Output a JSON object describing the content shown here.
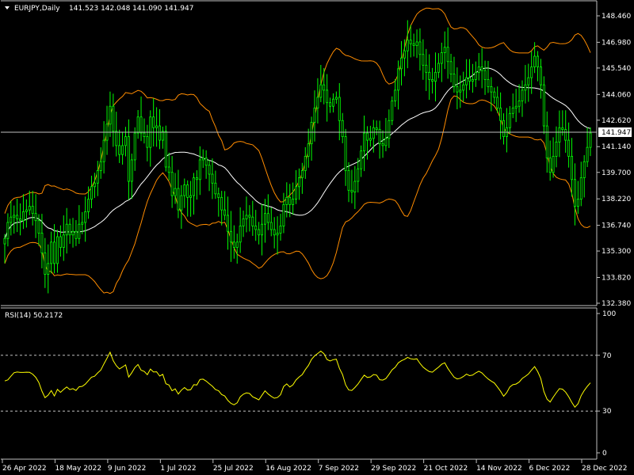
{
  "header": {
    "symbol": "EURJPY,Daily",
    "ohlc": "141.523 142.048 141.090 141.947",
    "current_price_label": "141.947"
  },
  "rsi_panel": {
    "label": "RSI(14) 50.2172",
    "levels": [
      30,
      70
    ]
  },
  "colors": {
    "background": "#000000",
    "candle": "#00ff00",
    "ma": "#ffffff",
    "bands": "#ff8c00",
    "rsi": "#ffff00",
    "grid": "#ffffff"
  },
  "chart_data": [
    {
      "type": "candlestick",
      "title": "EURJPY,Daily",
      "x_tick_labels": [
        "26 Apr 2022",
        "18 May 2022",
        "9 Jun 2022",
        "1 Jul 2022",
        "25 Jul 2022",
        "16 Aug 2022",
        "7 Sep 2022",
        "29 Sep 2022",
        "21 Oct 2022",
        "14 Nov 2022",
        "6 Dec 2022",
        "28 Dec 2022"
      ],
      "y_tick_labels": [
        148.46,
        146.98,
        145.54,
        144.06,
        142.62,
        141.14,
        139.7,
        138.22,
        136.74,
        135.3,
        133.82,
        132.38
      ],
      "ylim": [
        132.38,
        148.46
      ],
      "overlays": [
        "moving-average",
        "envelope-bands"
      ],
      "closes": [
        136.0,
        136.9,
        137.2,
        137.3,
        137.1,
        137.0,
        137.5,
        137.6,
        137.8,
        137.4,
        137.0,
        136.3,
        135.2,
        134.0,
        134.6,
        135.8,
        134.6,
        136.1,
        135.5,
        136.2,
        136.8,
        136.2,
        136.4,
        136.0,
        136.8,
        136.9,
        137.5,
        138.2,
        138.9,
        139.1,
        139.8,
        140.3,
        141.5,
        142.4,
        143.4,
        142.0,
        141.2,
        140.7,
        141.2,
        141.7,
        139.2,
        140.4,
        141.9,
        142.8,
        141.9,
        141.7,
        141.1,
        142.8,
        142.2,
        142.3,
        141.5,
        142.0,
        140.0,
        139.7,
        138.4,
        138.8,
        137.6,
        138.4,
        139.0,
        138.3,
        138.4,
        139.4,
        139.3,
        140.4,
        140.5,
        140.1,
        139.6,
        139.1,
        138.5,
        138.3,
        137.6,
        137.3,
        136.4,
        135.8,
        135.5,
        135.8,
        136.7,
        137.1,
        137.3,
        137.2,
        136.7,
        136.5,
        136.2,
        136.8,
        137.4,
        136.9,
        136.5,
        136.2,
        136.3,
        136.7,
        137.9,
        138.3,
        137.9,
        138.2,
        138.9,
        139.4,
        139.8,
        140.6,
        141.3,
        142.5,
        143.3,
        143.9,
        144.6,
        144.3,
        143.6,
        143.4,
        143.8,
        143.9,
        142.6,
        141.7,
        139.8,
        138.7,
        138.6,
        139.2,
        139.9,
        140.9,
        141.9,
        141.5,
        141.6,
        142.2,
        142.1,
        141.3,
        141.2,
        141.6,
        142.6,
        143.7,
        144.3,
        145.5,
        146.1,
        146.5,
        147.1,
        146.9,
        146.8,
        147.0,
        146.3,
        145.7,
        145.3,
        144.9,
        144.8,
        145.3,
        145.8,
        146.4,
        146.7,
        145.9,
        145.2,
        144.5,
        144.2,
        144.3,
        144.6,
        145.0,
        144.8,
        144.9,
        145.3,
        145.6,
        145.4,
        144.9,
        144.5,
        144.2,
        143.9,
        143.3,
        142.6,
        141.7,
        142.2,
        143.0,
        143.3,
        143.4,
        143.7,
        144.3,
        144.6,
        145.0,
        145.6,
        146.2,
        145.6,
        144.6,
        142.3,
        140.5,
        139.7,
        140.6,
        141.4,
        142.2,
        142.1,
        141.5,
        140.6,
        139.3,
        137.8,
        138.2,
        139.4,
        140.3,
        141.1,
        141.9
      ]
    },
    {
      "type": "line",
      "title": "RSI(14) 50.2172",
      "ylim": [
        0,
        100
      ],
      "y_tick_labels": [
        100,
        70,
        30,
        0
      ],
      "reference_lines": [
        30,
        70
      ],
      "values": [
        51.6,
        52.4,
        55.0,
        57.5,
        58.0,
        57.7,
        57.7,
        57.9,
        57.8,
        56.5,
        54.2,
        50.5,
        44.3,
        39.6,
        41.4,
        44.7,
        40.8,
        45.5,
        43.4,
        45.5,
        47.3,
        45.4,
        46.1,
        44.8,
        47.4,
        47.7,
        49.3,
        51.8,
        54.3,
        55.0,
        57.4,
        59.4,
        63.8,
        67.9,
        72.2,
        66.1,
        62.5,
        60.2,
        61.6,
        63.1,
        54.4,
        57.5,
        61.2,
        63.4,
        59.3,
        58.4,
        56.1,
        60.1,
        58.0,
        58.2,
        55.1,
        56.3,
        49.6,
        48.7,
        44.6,
        45.9,
        42.2,
        45.0,
        46.9,
        45.0,
        45.3,
        48.9,
        48.7,
        52.6,
        52.9,
        51.5,
        49.6,
        47.8,
        45.4,
        44.6,
        41.9,
        40.8,
        37.6,
        35.5,
        34.5,
        35.9,
        40.2,
        42.1,
        43.0,
        42.6,
        40.2,
        39.2,
        38.0,
        41.3,
        44.5,
        42.2,
        40.5,
        39.2,
        39.7,
        41.7,
        47.6,
        49.5,
        47.3,
        48.8,
        52.3,
        54.5,
        56.2,
        59.8,
        62.7,
        67.1,
        69.6,
        71.3,
        73.0,
        71.2,
        67.0,
        65.9,
        66.9,
        67.2,
        60.6,
        56.2,
        48.8,
        45.1,
        44.8,
        46.9,
        49.4,
        52.7,
        55.8,
        54.1,
        54.5,
        56.2,
        55.8,
        52.5,
        52.2,
        53.3,
        56.3,
        59.6,
        61.4,
        64.6,
        66.1,
        67.1,
        68.5,
        67.5,
        67.1,
        67.5,
        64.2,
        61.5,
        59.8,
        58.3,
        57.9,
        59.8,
        61.5,
        63.6,
        64.6,
        60.6,
        57.4,
        54.3,
        53.0,
        53.5,
        54.8,
        56.5,
        55.4,
        55.8,
        57.4,
        58.6,
        57.4,
        55.0,
        53.0,
        51.5,
        50.1,
        47.3,
        44.2,
        40.6,
        43.2,
        47.3,
        48.9,
        49.4,
        50.8,
        53.4,
        54.9,
        56.6,
        59.4,
        61.9,
        58.3,
        53.3,
        44.0,
        38.5,
        36.5,
        40.0,
        43.2,
        46.1,
        45.7,
        43.6,
        40.3,
        36.2,
        32.8,
        35.2,
        41.0,
        44.7,
        47.7,
        50.2
      ]
    }
  ]
}
